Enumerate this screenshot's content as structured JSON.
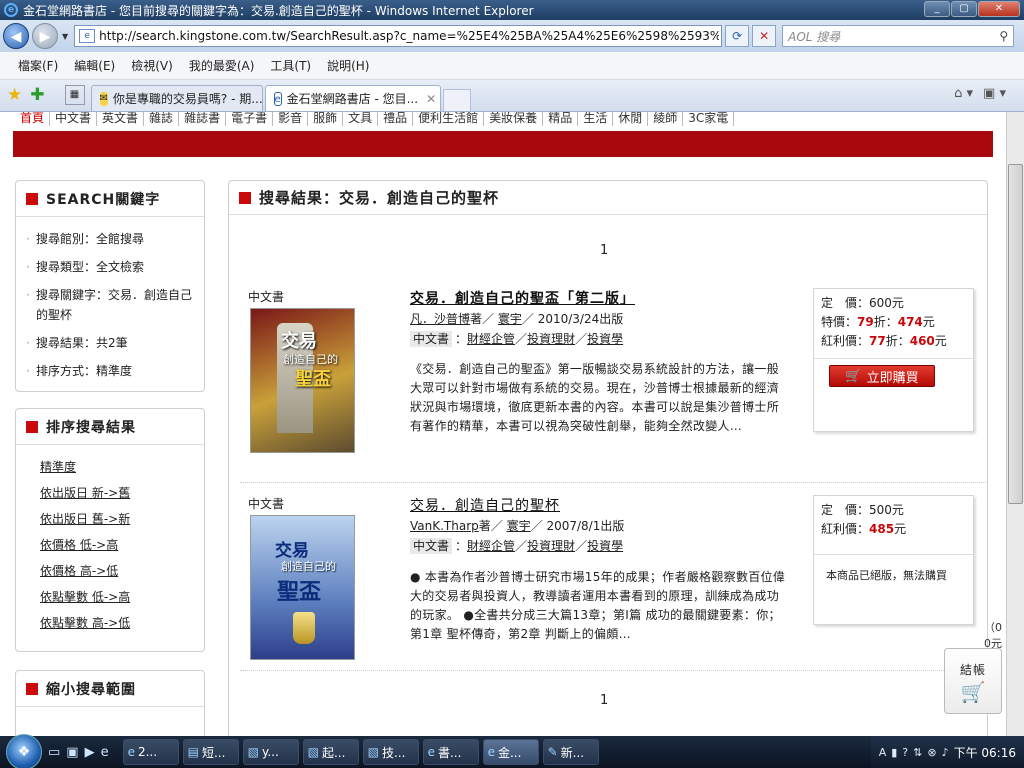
{
  "window": {
    "title": "金石堂網路書店 - 您目前搜尋的關鍵字為：交易.創造自己的聖杯 - Windows Internet Explorer"
  },
  "address": {
    "url": "http://search.kingstone.com.tw/SearchResult.asp?c_name=%25E4%25BA%25A4%25E6%2598%2593%25E...",
    "search_placeholder": "AOL 搜尋"
  },
  "menu": [
    "檔案(F)",
    "編輯(E)",
    "檢視(V)",
    "我的最愛(A)",
    "工具(T)",
    "說明(H)"
  ],
  "tabs": [
    {
      "label": "你是專職的交易員嗎? - 期..."
    },
    {
      "label": "金石堂網路書店 - 您目..."
    }
  ],
  "site_nav": [
    "首頁",
    "中文書",
    "英文書",
    "雜誌",
    "雜誌書",
    "電子書",
    "影音",
    "服飾",
    "文具",
    "禮品",
    "便利生活館",
    "美妝保養",
    "精品",
    "生活",
    "休閒",
    "綾師",
    "3C家電"
  ],
  "search_panel": {
    "title": "SEARCH關鍵字",
    "items": [
      "搜尋館別：全館搜尋",
      "搜尋類型：全文檢索",
      "搜尋關鍵字：交易．創造自己的聖杯",
      "搜尋結果：共2筆",
      "排序方式：精準度"
    ]
  },
  "sort_panel": {
    "title": "排序搜尋結果",
    "items": [
      "精準度",
      "依出版日 新->舊",
      "依出版日 舊->新",
      "依價格 低->高",
      "依價格 高->低",
      "依點擊數 低->高",
      "依點擊數 高->低"
    ]
  },
  "narrow_panel": {
    "title": "縮小搜尋範圍"
  },
  "results": {
    "title": "搜尋結果：交易．創造自己的聖杯",
    "page_top": "1",
    "page_bottom": "1",
    "books": [
      {
        "category": "中文書",
        "title": "交易．創造自己的聖盃「第二版」",
        "author": "凡．沙普博",
        "author_suffix": "著／",
        "publisher": "寰宇",
        "date": "／ 2010/3/24出版",
        "tag": "中文書",
        "cats": [
          "財經企管",
          "投資理財",
          "投資學"
        ],
        "description": "《交易．創造自己的聖盃》第一版暢談交易系統設計的方法，讓一般大眾可以針對市場做有系統的交易。現在，沙普博士根據最新的經濟狀況與市場環境，徹底更新本書的內容。本書可以說是集沙普博士所有著作的精華，本書可以視為突破性創舉，能夠全然改變人…",
        "cover_text": [
          "交易",
          "創造自己的",
          "聖盃"
        ],
        "price_list_label": "定　價：",
        "price_list": "600元",
        "special_label": "特價：",
        "special_discount": "79",
        "special_price": "474",
        "bonus_label": "紅利價：",
        "bonus_discount": "77",
        "bonus_price": "460",
        "buy_label": "立即購買"
      },
      {
        "category": "中文書",
        "title": "交易．創造自己的聖杯",
        "author": "VanK.Tharp",
        "author_suffix": "著／",
        "publisher": "寰宇",
        "date": "／ 2007/8/1出版",
        "tag": "中文書",
        "cats": [
          "財經企管",
          "投資理財",
          "投資學"
        ],
        "description": "● 本書為作者沙普博士研究市場15年的成果；作者嚴格觀察數百位偉大的交易者與投資人，教導讀者運用本書看到的原理，訓練成為成功的玩家。 ●全書共分成三大篇13章；第I篇 成功的最關鍵要素：你；第1章 聖杯傳奇，第2章 判斷上的偏頗…",
        "cover_text": [
          "交易",
          "創造自己的",
          "聖盃"
        ],
        "price_list_label": "定　價：",
        "price_list": "500元",
        "bonus_label": "紅利價：",
        "bonus_price": "485",
        "status": "本商品已絕版，無法購買"
      }
    ]
  },
  "cart": {
    "label": "結帳",
    "count_line1": "（0",
    "count_line2": "0元"
  },
  "taskbar": {
    "items": [
      "2...",
      "短...",
      "y...",
      "起...",
      "技...",
      "書...",
      "金...",
      "新..."
    ],
    "clock": "下午 06:16"
  },
  "colors": {
    "brand_red": "#a8090c",
    "price_red": "#c8080a"
  }
}
